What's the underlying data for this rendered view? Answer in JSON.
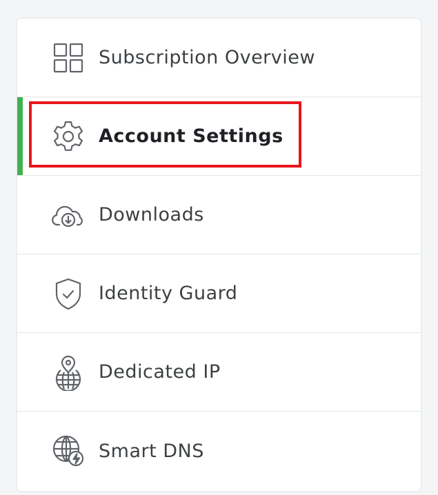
{
  "colors": {
    "accent": "#3fb24f",
    "highlight": "#e8151d",
    "icon_stroke": "#5f6368"
  },
  "menu": {
    "items": [
      {
        "label": "Subscription Overview",
        "icon": "grid-icon",
        "active": false
      },
      {
        "label": "Account Settings",
        "icon": "gear-icon",
        "active": true
      },
      {
        "label": "Downloads",
        "icon": "cloud-download-icon",
        "active": false
      },
      {
        "label": "Identity Guard",
        "icon": "shield-check-icon",
        "active": false
      },
      {
        "label": "Dedicated IP",
        "icon": "globe-pin-icon",
        "active": false
      },
      {
        "label": "Smart DNS",
        "icon": "globe-bolt-icon",
        "active": false
      }
    ]
  }
}
